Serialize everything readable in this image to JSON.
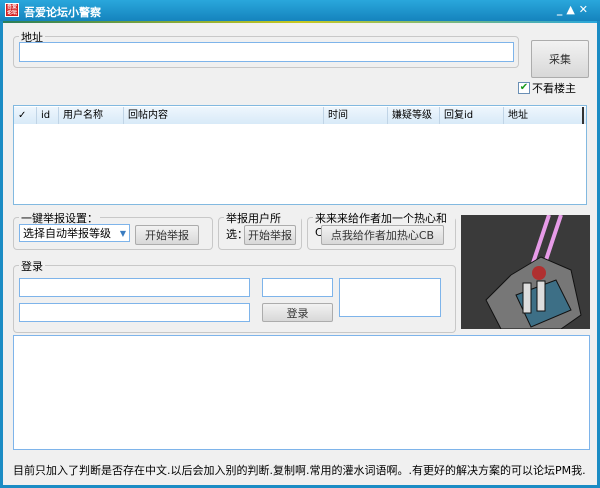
{
  "window": {
    "title": "吾爱论坛小警察",
    "logo_text": "吾爱论坛",
    "controls": [
      "_",
      "▲",
      "✕"
    ]
  },
  "address": {
    "legend": "地址",
    "value": "",
    "collect_label": "采集"
  },
  "options": {
    "hide_op_label": "不看楼主",
    "hide_op_checked": true
  },
  "list": {
    "columns": [
      "✓",
      "id",
      "用户名称",
      "回帖内容",
      "时间",
      "嫌疑等级",
      "回复id",
      "地址"
    ],
    "rows": []
  },
  "auto_report": {
    "legend": "一键举报设置：",
    "select_value": "选择自动举报等级",
    "start_label": "开始举报"
  },
  "report_selected": {
    "legend": "举报用户所选：",
    "start_label": "开始举报"
  },
  "support": {
    "legend": "来来来给作者加一个热心和CB",
    "button_label": "点我给作者加热心CB"
  },
  "login": {
    "legend": "登录",
    "username": "",
    "password": "",
    "captcha": "",
    "login_label": "登录"
  },
  "log": {
    "value": ""
  },
  "status_text": "目前只加入了判断是否存在中文.以后会加入别的判断.复制啊.常用的灌水词语啊。.有更好的解决方案的可以论坛PM我."
}
